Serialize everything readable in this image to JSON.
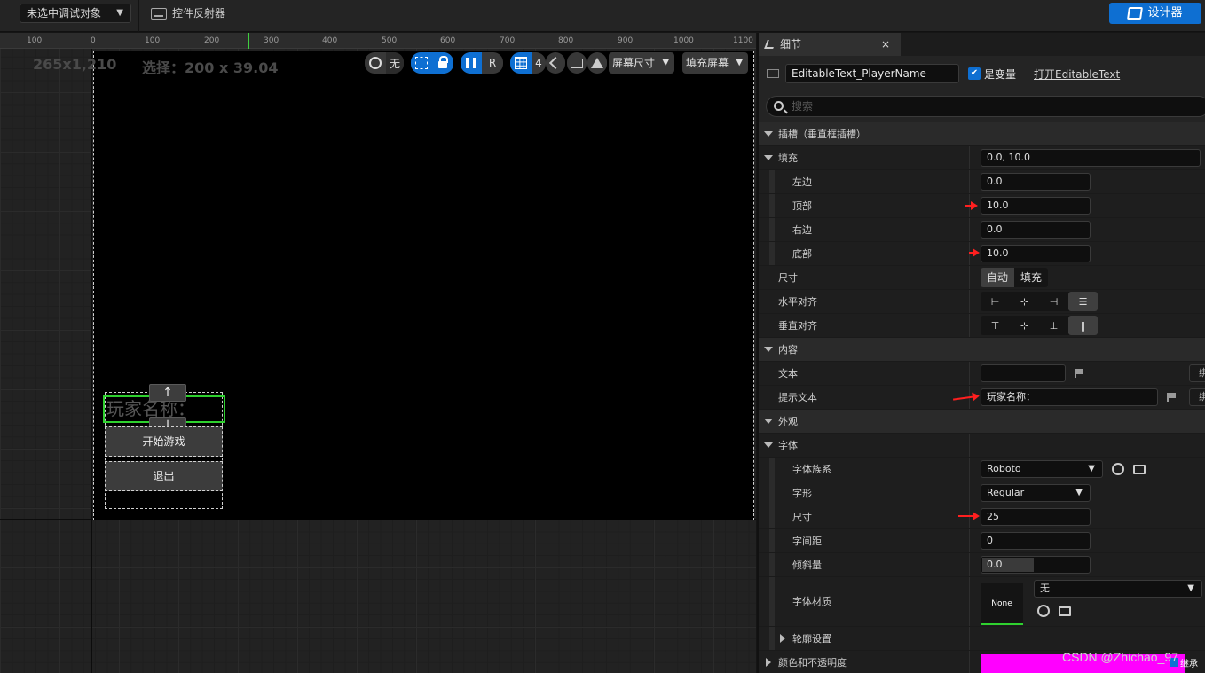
{
  "topbar": {
    "debug_select": "未选中调试对象",
    "reflector": "控件反射器",
    "designer": "设计器"
  },
  "canvas": {
    "ruler_labels": [
      "100",
      "0",
      "100",
      "200",
      "300",
      "400",
      "500",
      "600",
      "700",
      "800",
      "900",
      "1000",
      "1100"
    ],
    "size_readout": "265x1,210",
    "selection_readout": "选择：200 x 39.04",
    "toolbar": {
      "world_none": "无",
      "r_label": "R",
      "grid_size": "4",
      "screen_size": "屏幕尺寸",
      "fill_screen": "填充屏幕"
    },
    "widgets": {
      "name_hint": "玩家名称：",
      "handle_up": "↑",
      "handle_down": "↓",
      "start_button": "开始游戏",
      "exit_button": "退出"
    }
  },
  "details": {
    "tab_title": "细节",
    "close": "×",
    "widget_name": "EditableText_PlayerName",
    "is_variable_label": "是变量",
    "open_link": "打开EditableText",
    "search_placeholder": "搜索",
    "slot_section": "插槽（垂直框插槽）",
    "padding_label": "填充",
    "padding_value": "0.0, 10.0",
    "left_label": "左边",
    "left_value": "0.0",
    "top_label": "顶部",
    "top_value": "10.0",
    "right_label": "右边",
    "right_value": "0.0",
    "bottom_label": "底部",
    "bottom_value": "10.0",
    "size_label": "尺寸",
    "size_auto": "自动",
    "size_fill": "填充",
    "halign_label": "水平对齐",
    "valign_label": "垂直对齐",
    "content_section": "内容",
    "text_label": "文本",
    "text_value": "",
    "hint_label": "提示文本",
    "hint_value": "玩家名称：",
    "ext_label": "绑",
    "appearance_section": "外观",
    "font_section": "字体",
    "font_family_label": "字体族系",
    "font_family_value": "Roboto",
    "typeface_label": "字形",
    "typeface_value": "Regular",
    "font_size_label": "尺寸",
    "font_size_value": "25",
    "letter_spacing_label": "字间距",
    "letter_spacing_value": "0",
    "skew_label": "倾斜量",
    "skew_value": "0.0",
    "font_material_label": "字体材质",
    "font_material_thumb": "None",
    "font_material_value": "无",
    "outline_label": "轮廓设置",
    "color_label": "颜色和不透明度",
    "inherit_label": "继承"
  },
  "colors": {
    "accent": "#0e6fd2",
    "selection": "#2fd12f",
    "swatch": "#ff00ff",
    "annotation": "#ff1f1f"
  },
  "watermark": "CSDN @Zhichao_97"
}
